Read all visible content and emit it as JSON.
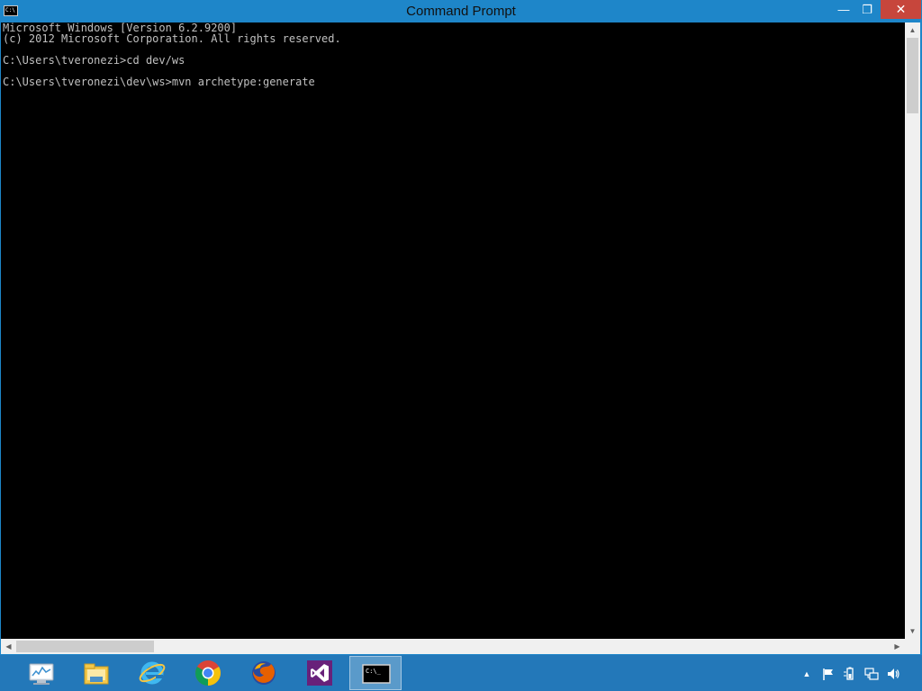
{
  "window": {
    "title": "Command Prompt",
    "app_icon_text": "C:\\",
    "minimize_label": "—",
    "maximize_label": "❐",
    "close_label": "✕"
  },
  "console": {
    "lines": [
      "Microsoft Windows [Version 6.2.9200]",
      "(c) 2012 Microsoft Corporation. All rights reserved.",
      "",
      "C:\\Users\\tveronezi>cd dev/ws",
      "",
      "C:\\Users\\tveronezi\\dev\\ws>mvn archetype:generate"
    ]
  },
  "scrollbars": {
    "up_arrow": "▲",
    "down_arrow": "▼",
    "left_arrow": "◀",
    "right_arrow": "▶"
  },
  "taskbar": {
    "items": [
      {
        "icon": "task-manager-icon",
        "active": false
      },
      {
        "icon": "file-explorer-icon",
        "active": false
      },
      {
        "icon": "internet-explorer-icon",
        "active": false
      },
      {
        "icon": "chrome-icon",
        "active": false
      },
      {
        "icon": "firefox-icon",
        "active": false
      },
      {
        "icon": "visual-studio-icon",
        "active": false
      },
      {
        "icon": "command-prompt-icon",
        "active": true
      }
    ],
    "active_task_text": "C:\\_"
  },
  "tray": {
    "show_hidden_label": "▲",
    "icons": [
      "action-center-flag-icon",
      "power-icon",
      "network-icon",
      "volume-icon"
    ]
  },
  "colors": {
    "titlebar": "#1e86c9",
    "close_button": "#c7463c",
    "console_bg": "#000000",
    "console_text": "#c0c0c0",
    "taskbar": "#2378b9"
  }
}
